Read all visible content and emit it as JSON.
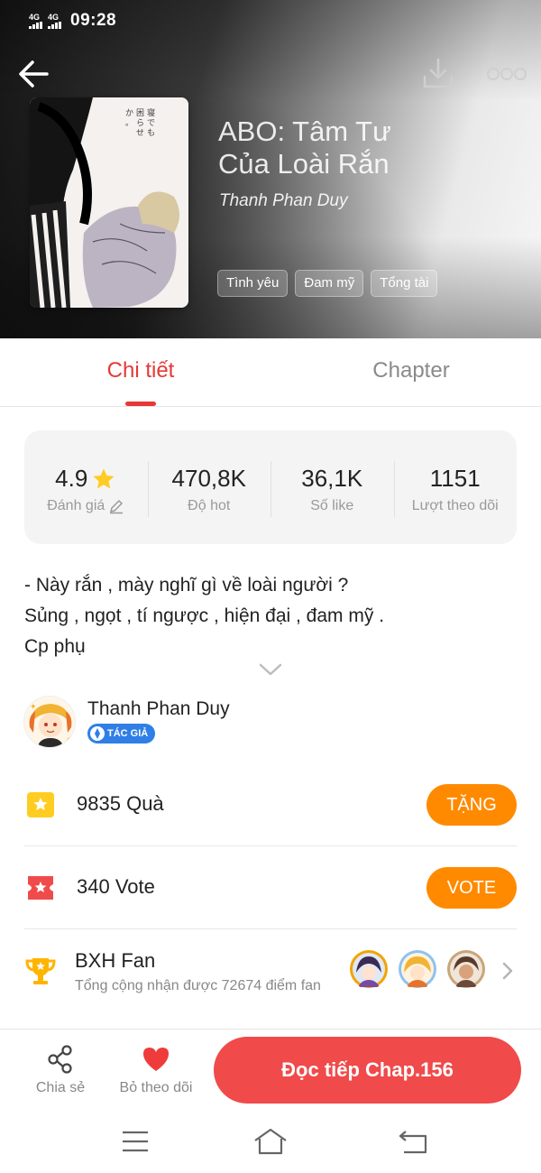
{
  "status_bar": {
    "signal1": "4G",
    "signal2": "4G",
    "time": "09:28"
  },
  "header": {
    "title": "ABO: Tâm Tư Của Loài Rắn",
    "author": "Thanh Phan Duy",
    "tags": [
      "Tình yêu",
      "Đam mỹ",
      "Tổng tài"
    ]
  },
  "tabs": {
    "details": "Chi tiết",
    "chapter": "Chapter"
  },
  "stats": [
    {
      "value": "4.9",
      "label": "Đánh giá"
    },
    {
      "value": "470,8K",
      "label": "Độ hot"
    },
    {
      "value": "36,1K",
      "label": "Số like"
    },
    {
      "value": "1151",
      "label": "Lượt theo dõi"
    }
  ],
  "description": {
    "line1": "- Này rắn , mày nghĩ gì về loài người ?",
    "line2": "Sủng , ngọt , tí ngược , hiện đại , đam mỹ .",
    "line3": "Cp phụ"
  },
  "author": {
    "name": "Thanh Phan Duy",
    "badge": "TÁC GIẢ"
  },
  "gifts": {
    "count": "9835",
    "label": "Quà",
    "button": "TẶNG"
  },
  "votes": {
    "count": "340",
    "label": "Vote",
    "button": "VOTE"
  },
  "fan_ranking": {
    "title": "BXH Fan",
    "subtitle": "Tổng cộng nhận được 72674 điểm fan"
  },
  "bottom_bar": {
    "share": "Chia sẻ",
    "unfollow": "Bỏ theo dõi",
    "read_button": "Đọc tiếp Chap.156"
  },
  "colors": {
    "accent": "#e53935",
    "orange": "#ff8a00",
    "read_button": "#f04a4a",
    "badge_blue": "#2f7fe6",
    "gold": "#ffcc22"
  },
  "icons": [
    "back-arrow-icon",
    "download-icon",
    "more-icon",
    "star-icon",
    "edit-icon",
    "chevron-down-icon",
    "gift-icon",
    "ticket-icon",
    "trophy-icon",
    "chevron-right-icon",
    "share-icon",
    "heart-icon",
    "menu-icon",
    "home-icon",
    "return-icon"
  ]
}
